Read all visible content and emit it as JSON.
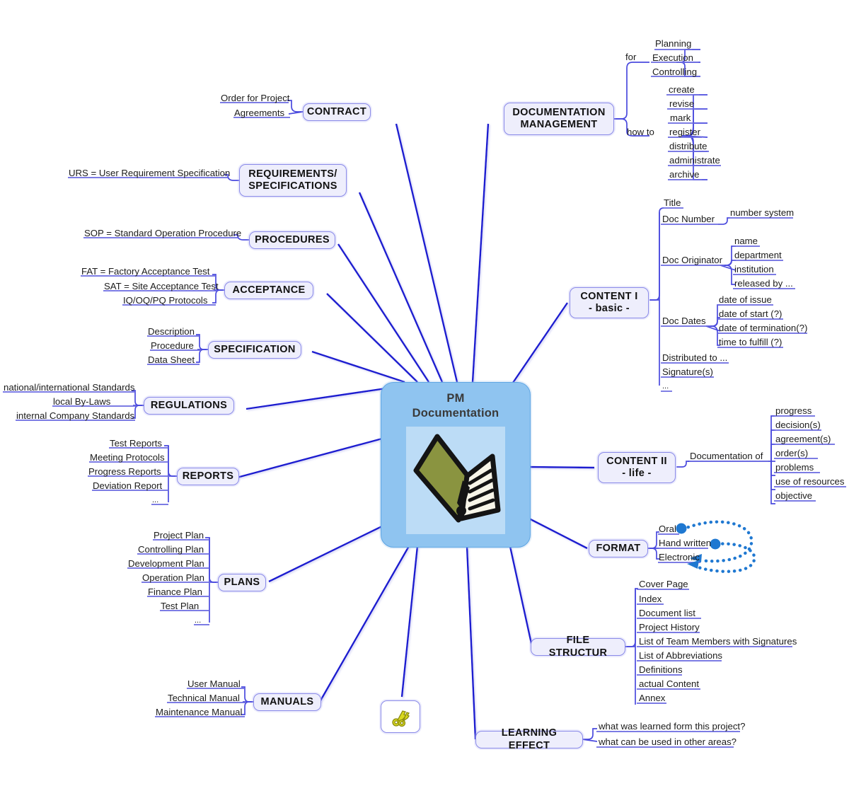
{
  "root": {
    "title_line1": "PM",
    "title_line2": "Documentation",
    "image_name": "open-book-folder-image"
  },
  "colors": {
    "root_fill": "#8fc4f0",
    "root_border": "#5fa6e4",
    "root_image_bg": "#bcdcf6",
    "node_fill": "#eeeefc",
    "node_border": "#8a8ae8",
    "main_wire": "#1a1ad0",
    "sub_wire": "#6a6ae0",
    "arrow_dots": "#1f78d1",
    "book_cover": "#8a9440",
    "keys_icon": "#c8c818"
  },
  "icon_node": {
    "name": "keys-icon",
    "label": ""
  },
  "branches": {
    "documentation_management": {
      "label": "DOCUMENTATION\nMANAGEMENT",
      "groups": [
        {
          "label": "for",
          "items": [
            "Planning",
            "Execution",
            "Controlling"
          ]
        },
        {
          "label": "how to",
          "items": [
            "create",
            "revise",
            "mark",
            "register",
            "distribute",
            "administrate",
            "archive"
          ]
        }
      ]
    },
    "content_i": {
      "label": "CONTENT I\n- basic -",
      "items": [
        {
          "label": "Title",
          "children": []
        },
        {
          "label": "Doc Number",
          "children": [
            "number system"
          ]
        },
        {
          "label": "Doc Originator",
          "children": [
            "name",
            "department",
            "institution",
            "released by ..."
          ]
        },
        {
          "label": "Doc Dates",
          "children": [
            "date of issue",
            "date of start (?)",
            "date of termination(?)",
            "time to fulfill (?)"
          ]
        },
        {
          "label": "Distributed to ...",
          "children": []
        },
        {
          "label": "Signature(s)",
          "children": []
        },
        {
          "label": "...",
          "children": []
        }
      ]
    },
    "content_ii": {
      "label": "CONTENT II\n- life -",
      "group_label": "Documentation of",
      "items": [
        "progress",
        "decision(s)",
        "agreement(s)",
        "order(s)",
        "problems",
        "use of resources",
        "objective"
      ]
    },
    "format": {
      "label": "FORMAT",
      "items": [
        "Oral",
        "Hand written",
        "Electronic"
      ],
      "arrows": [
        {
          "from": "Oral",
          "to": "Electronic"
        },
        {
          "from": "Hand written",
          "to": "Electronic"
        }
      ]
    },
    "file_structur": {
      "label": "FILE STRUCTUR",
      "items": [
        "Cover Page",
        "Index",
        "Document list",
        "Project History",
        "List of Team Members with Signatures",
        "List of Abbreviations",
        "Definitions",
        "actual Content",
        "Annex"
      ]
    },
    "learning_effect": {
      "label": "LEARNING EFFECT",
      "items": [
        "what was learned form this project?",
        "what can be used in other areas?"
      ]
    },
    "contract": {
      "label": "CONTRACT",
      "items": [
        "Order for Project",
        "Agreements"
      ]
    },
    "requirements_specifications": {
      "label": "REQUIREMENTS/\nSPECIFICATIONS",
      "items": [
        "URS = User Requirement Specification"
      ]
    },
    "procedures": {
      "label": "PROCEDURES",
      "items": [
        "SOP = Standard Operation Procedure"
      ]
    },
    "acceptance": {
      "label": "ACCEPTANCE",
      "items": [
        "FAT = Factory Acceptance Test",
        "SAT = Site Acceptance Test",
        "IQ/OQ/PQ Protocols"
      ]
    },
    "specification": {
      "label": "SPECIFICATION",
      "items": [
        "Description",
        "Procedure",
        "Data Sheet"
      ]
    },
    "regulations": {
      "label": "REGULATIONS",
      "items": [
        "national/international Standards",
        "local By-Laws",
        "internal Company Standards"
      ]
    },
    "reports": {
      "label": "REPORTS",
      "items": [
        "Test Reports",
        "Meeting Protocols",
        "Progress Reports",
        "Deviation Report",
        "..."
      ]
    },
    "plans": {
      "label": "PLANS",
      "items": [
        "Project Plan",
        "Controlling Plan",
        "Development Plan",
        "Operation Plan",
        "Finance Plan",
        "Test Plan",
        "..."
      ]
    },
    "manuals": {
      "label": "MANUALS",
      "items": [
        "User Manual",
        "Technical Manual",
        "Maintenance Manual"
      ]
    }
  }
}
